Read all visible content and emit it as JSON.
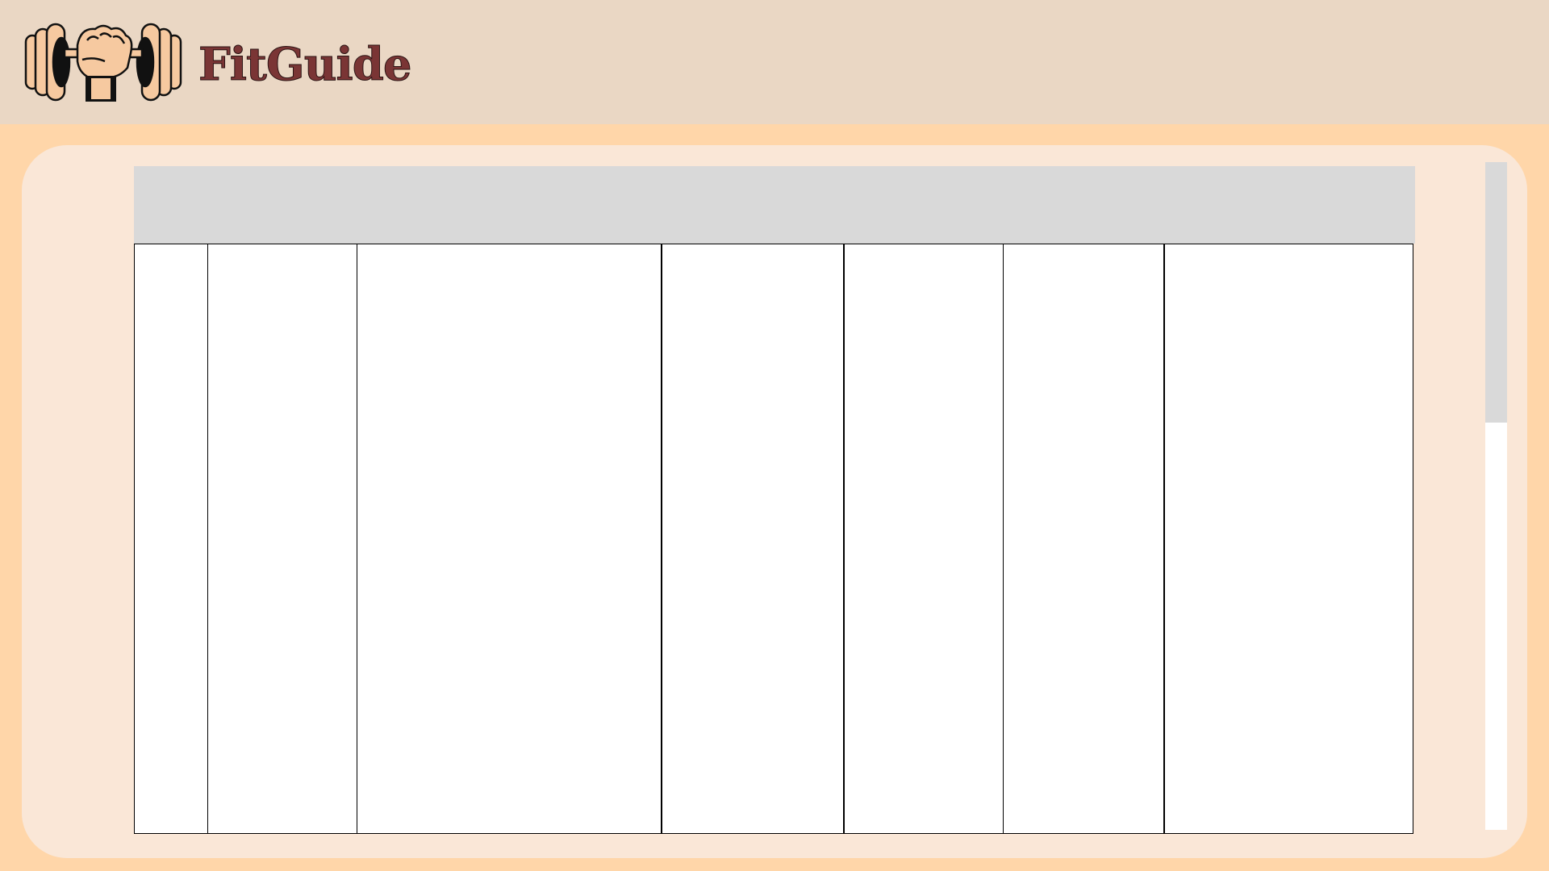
{
  "app": {
    "brand_name": "FitGuide",
    "logo_icon": "dumbbell-fist-icon"
  },
  "colors": {
    "page_background": "#FFD6A9",
    "header_background": "#EAD7C4",
    "panel_background": "#FAE7D7",
    "brand_text": "#7A3535",
    "table_header": "#D9D9D9",
    "table_cell": "#FFFFFF",
    "grid_line": "#000000",
    "scroll_thumb": "#D9D9D9",
    "scroll_track": "#FFFFFF"
  },
  "table": {
    "column_count": 7,
    "header_labels": [
      "",
      "",
      "",
      "",
      "",
      "",
      ""
    ],
    "rows": []
  },
  "scrollbar": {
    "thumb_fraction": 0.39,
    "scroll_position": 0
  }
}
